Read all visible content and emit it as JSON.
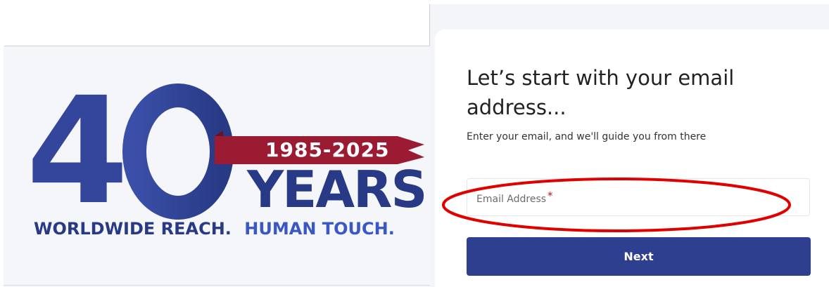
{
  "logo": {
    "number": "40",
    "years_range": "1985-2025",
    "years_word": "YEARS",
    "tagline_part1": "WORLDWIDE REACH.",
    "tagline_part2": "HUMAN TOUCH."
  },
  "form": {
    "heading": "Let’s start with your email address...",
    "subtext": "Enter your email, and we'll guide you from there",
    "email_label": "Email Address",
    "required_marker": "*",
    "email_value": "",
    "next_label": "Next"
  },
  "colors": {
    "brand_navy": "#2e3f8f",
    "brand_crimson": "#9b1b33",
    "annotation_red": "#e00000"
  }
}
